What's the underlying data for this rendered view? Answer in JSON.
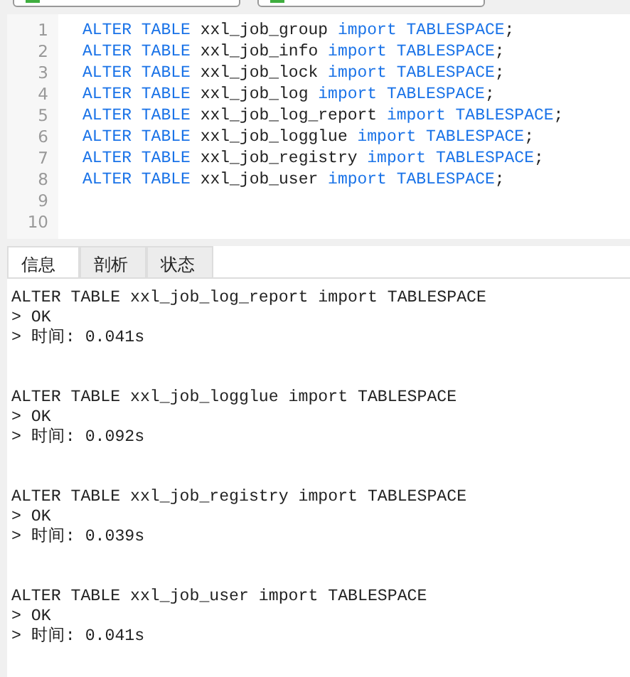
{
  "editor": {
    "lines": [
      {
        "number": "1",
        "segments": [
          {
            "kind": "keyword",
            "text": "ALTER TABLE"
          },
          {
            "kind": "identifier",
            "text": " xxl_job_group "
          },
          {
            "kind": "keyword",
            "text": "import TABLESPACE"
          },
          {
            "kind": "punct",
            "text": ";"
          }
        ]
      },
      {
        "number": "2",
        "segments": [
          {
            "kind": "keyword",
            "text": "ALTER TABLE"
          },
          {
            "kind": "identifier",
            "text": " xxl_job_info "
          },
          {
            "kind": "keyword",
            "text": "import TABLESPACE"
          },
          {
            "kind": "punct",
            "text": ";"
          }
        ]
      },
      {
        "number": "3",
        "segments": [
          {
            "kind": "keyword",
            "text": "ALTER TABLE"
          },
          {
            "kind": "identifier",
            "text": " xxl_job_lock "
          },
          {
            "kind": "keyword",
            "text": "import TABLESPACE"
          },
          {
            "kind": "punct",
            "text": ";"
          }
        ]
      },
      {
        "number": "4",
        "segments": [
          {
            "kind": "keyword",
            "text": "ALTER TABLE"
          },
          {
            "kind": "identifier",
            "text": " xxl_job_log "
          },
          {
            "kind": "keyword",
            "text": "import TABLESPACE"
          },
          {
            "kind": "punct",
            "text": ";"
          }
        ]
      },
      {
        "number": "5",
        "segments": [
          {
            "kind": "keyword",
            "text": "ALTER TABLE"
          },
          {
            "kind": "identifier",
            "text": " xxl_job_log_report "
          },
          {
            "kind": "keyword",
            "text": "import TABLESPACE"
          },
          {
            "kind": "punct",
            "text": ";"
          }
        ]
      },
      {
        "number": "6",
        "segments": [
          {
            "kind": "keyword",
            "text": "ALTER TABLE"
          },
          {
            "kind": "identifier",
            "text": " xxl_job_logglue "
          },
          {
            "kind": "keyword",
            "text": "import TABLESPACE"
          },
          {
            "kind": "punct",
            "text": ";"
          }
        ]
      },
      {
        "number": "7",
        "segments": [
          {
            "kind": "keyword",
            "text": "ALTER TABLE"
          },
          {
            "kind": "identifier",
            "text": " xxl_job_registry "
          },
          {
            "kind": "keyword",
            "text": "import TABLESPACE"
          },
          {
            "kind": "punct",
            "text": ";"
          }
        ]
      },
      {
        "number": "8",
        "segments": [
          {
            "kind": "keyword",
            "text": "ALTER TABLE"
          },
          {
            "kind": "identifier",
            "text": " xxl_job_user "
          },
          {
            "kind": "keyword",
            "text": "import TABLESPACE"
          },
          {
            "kind": "punct",
            "text": ";"
          }
        ]
      },
      {
        "number": "9"
      },
      {
        "number": "10"
      }
    ]
  },
  "tabs": [
    {
      "label": "信息",
      "selected": true
    },
    {
      "label": "剖析",
      "selected": false
    },
    {
      "label": "状态",
      "selected": false
    }
  ],
  "results": [
    {
      "statement": "ALTER TABLE xxl_job_log_report import TABLESPACE",
      "lines": [
        "> OK",
        "> 时间: 0.041s"
      ]
    },
    {
      "statement": "ALTER TABLE xxl_job_logglue import TABLESPACE",
      "lines": [
        "> OK",
        "> 时间: 0.092s"
      ]
    },
    {
      "statement": "ALTER TABLE xxl_job_registry import TABLESPACE",
      "lines": [
        "> OK",
        "> 时间: 0.039s"
      ]
    },
    {
      "statement": "ALTER TABLE xxl_job_user import TABLESPACE",
      "lines": [
        "> OK",
        "> 时间: 0.041s"
      ]
    }
  ]
}
